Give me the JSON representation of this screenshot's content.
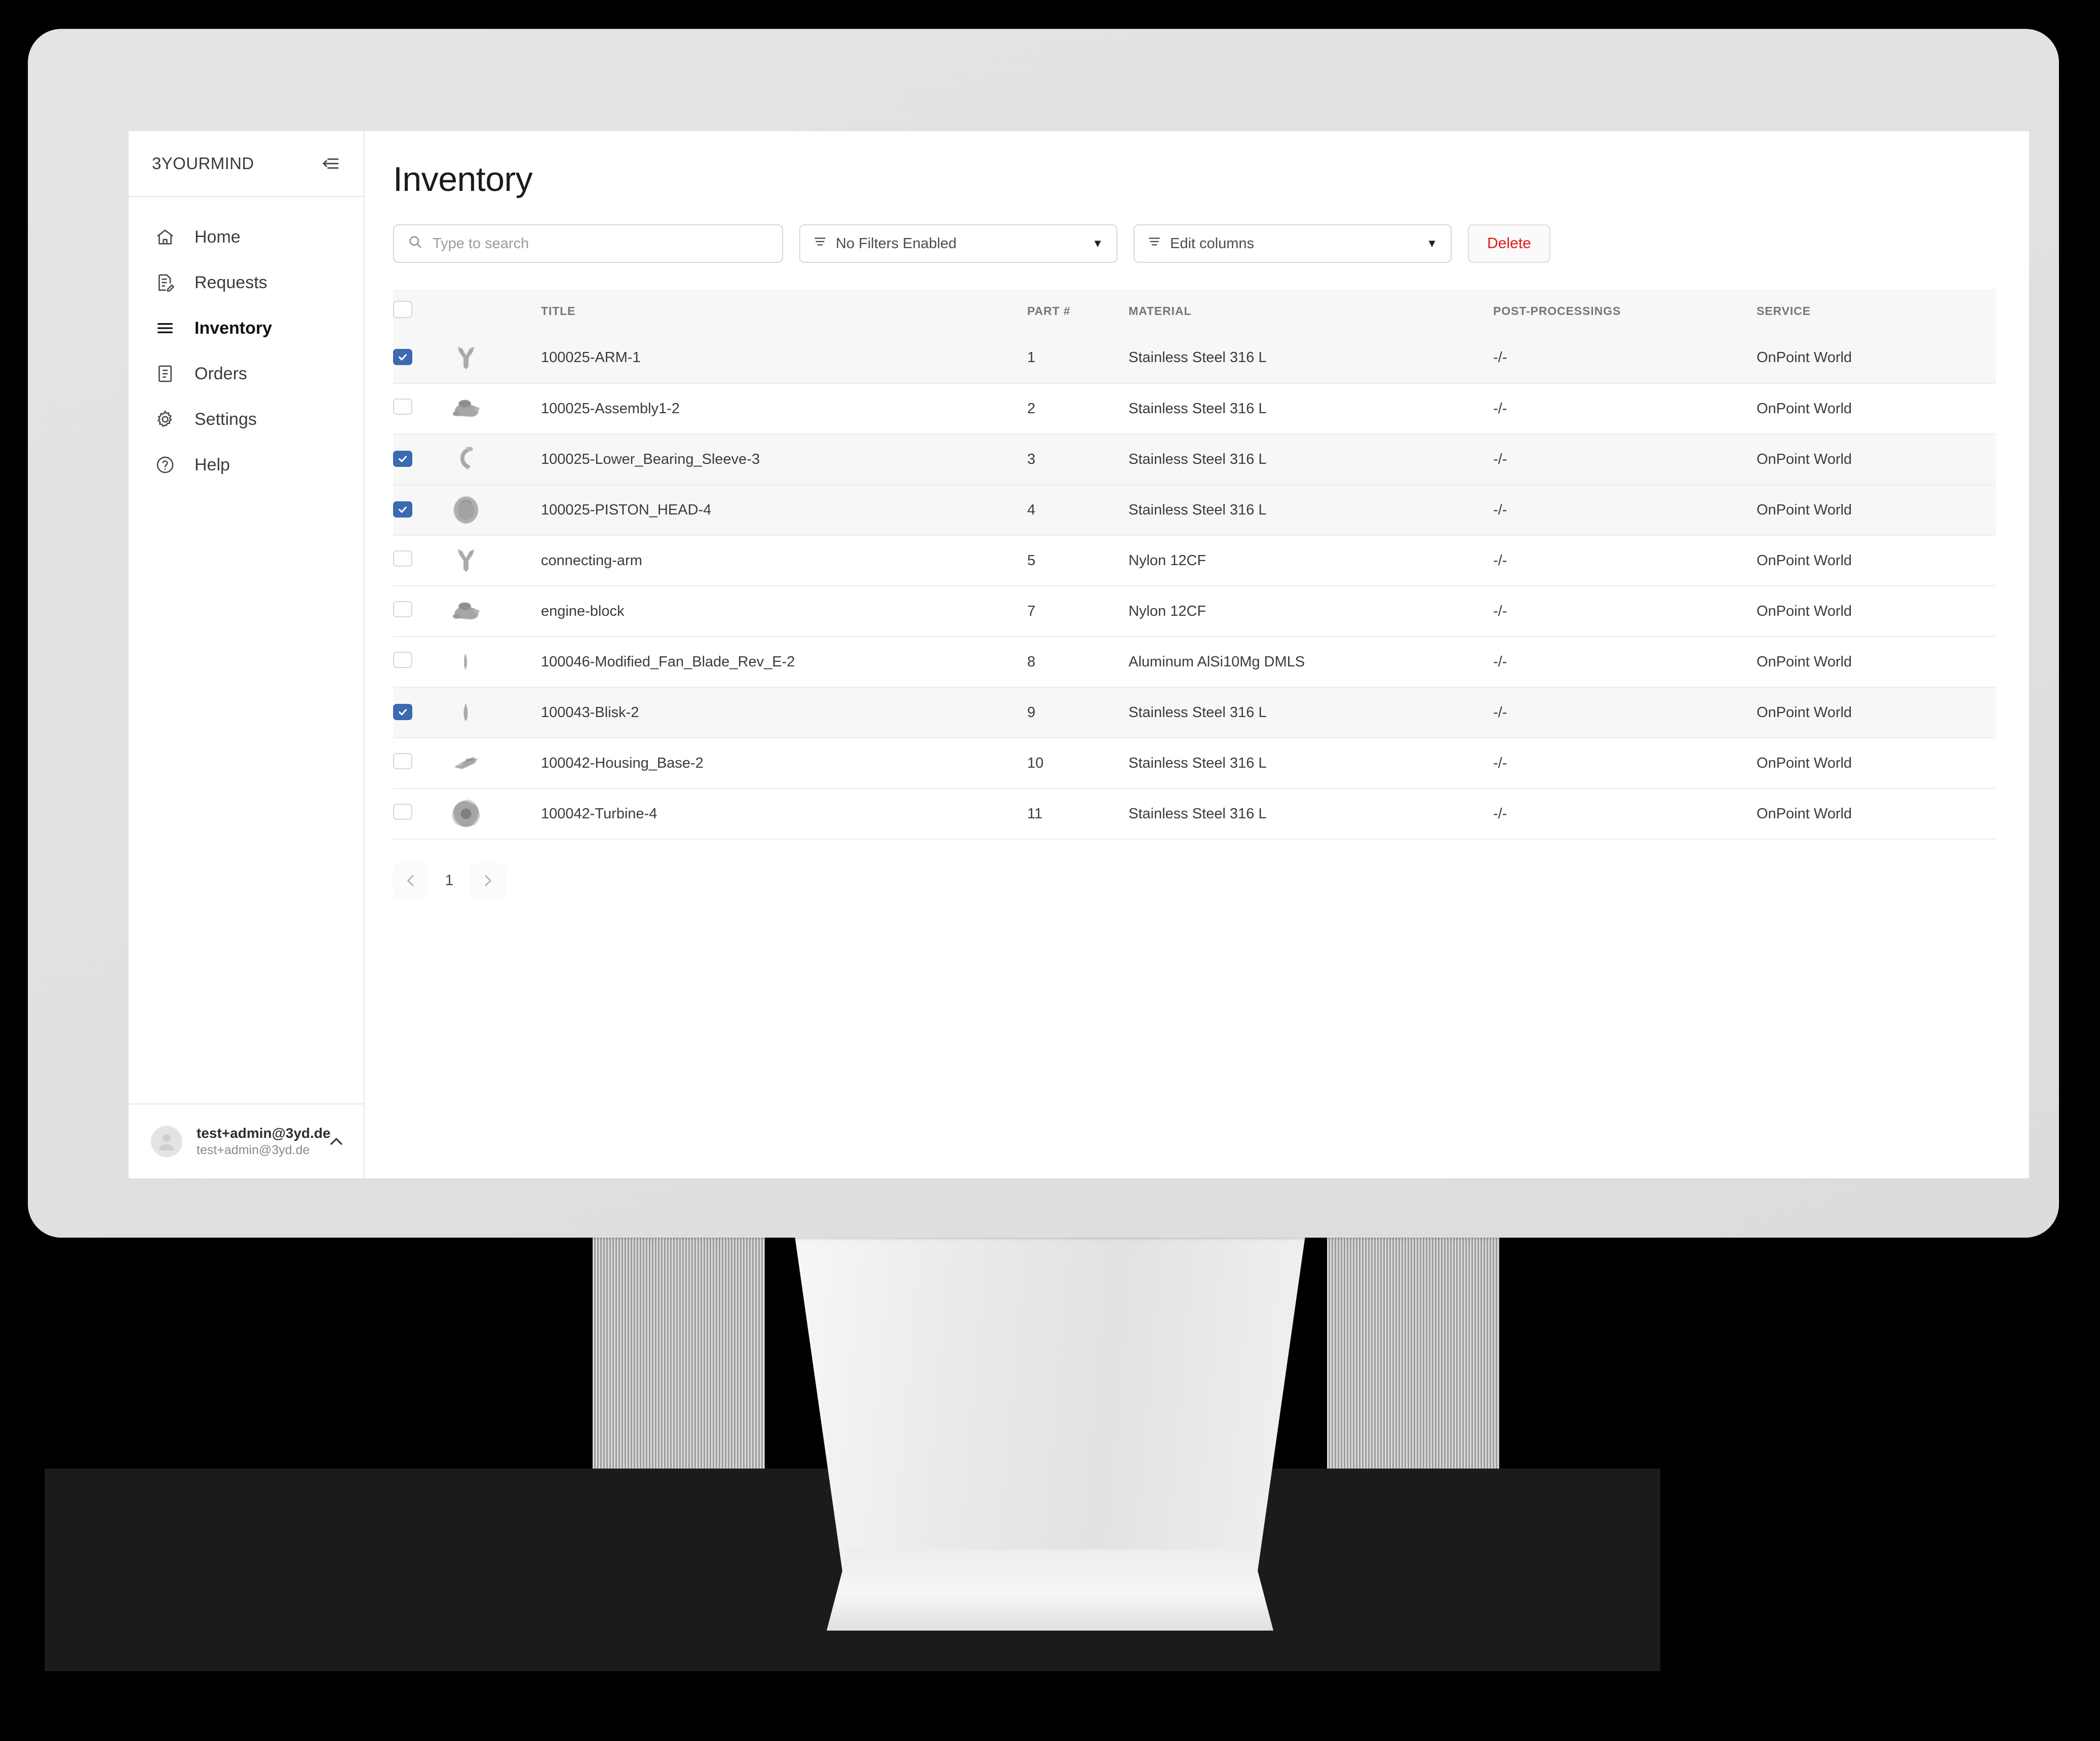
{
  "sidebar": {
    "brand": "3YOURMIND",
    "collapse_icon": "collapse-sidebar-icon",
    "items": [
      {
        "label": "Home",
        "icon": "home-icon",
        "active": false
      },
      {
        "label": "Requests",
        "icon": "document-edit-icon",
        "active": false
      },
      {
        "label": "Inventory",
        "icon": "list-icon",
        "active": true
      },
      {
        "label": "Orders",
        "icon": "document-icon",
        "active": false
      },
      {
        "label": "Settings",
        "icon": "gear-icon",
        "active": false
      },
      {
        "label": "Help",
        "icon": "question-circle-icon",
        "active": false
      }
    ],
    "user": {
      "name": "test+admin@3yd.de",
      "email": "test+admin@3yd.de",
      "chevron_icon": "chevron-up-icon",
      "avatar_icon": "user-avatar-icon"
    }
  },
  "main": {
    "title": "Inventory",
    "toolbar": {
      "search_placeholder": "Type to search",
      "search_value": "",
      "search_icon": "search-icon",
      "filters_label": "No Filters Enabled",
      "filters_icon": "filter-icon",
      "columns_label": "Edit columns",
      "columns_icon": "filter-icon",
      "caret": "▼",
      "delete_label": "Delete",
      "delete_color": "#e01919"
    },
    "table": {
      "columns": [
        "TITLE",
        "PART #",
        "MATERIAL",
        "POST-PROCESSINGS",
        "SERVICE"
      ],
      "header_checkbox_checked": false,
      "rows": [
        {
          "selected": true,
          "thumb": "y-bracket-part-thumbnail",
          "title": "100025-ARM-1",
          "part": "1",
          "material": "Stainless Steel 316 L",
          "post": "-/-",
          "service": "OnPoint World"
        },
        {
          "selected": false,
          "thumb": "engine-block-part-thumbnail",
          "title": "100025-Assembly1-2",
          "part": "2",
          "material": "Stainless Steel 316 L",
          "post": "-/-",
          "service": "OnPoint World"
        },
        {
          "selected": true,
          "thumb": "sleeve-part-thumbnail",
          "title": "100025-Lower_Bearing_Sleeve-3",
          "part": "3",
          "material": "Stainless Steel 316 L",
          "post": "-/-",
          "service": "OnPoint World"
        },
        {
          "selected": true,
          "thumb": "piston-head-part-thumbnail",
          "title": "100025-PISTON_HEAD-4",
          "part": "4",
          "material": "Stainless Steel 316 L",
          "post": "-/-",
          "service": "OnPoint World"
        },
        {
          "selected": false,
          "thumb": "y-bracket-part-thumbnail",
          "title": "connecting-arm",
          "part": "5",
          "material": "Nylon 12CF",
          "post": "-/-",
          "service": "OnPoint World"
        },
        {
          "selected": false,
          "thumb": "engine-block-part-thumbnail",
          "title": "engine-block",
          "part": "7",
          "material": "Nylon 12CF",
          "post": "-/-",
          "service": "OnPoint World"
        },
        {
          "selected": false,
          "thumb": "fan-blade-part-thumbnail",
          "title": "100046-Modified_Fan_Blade_Rev_E-2",
          "part": "8",
          "material": "Aluminum AlSi10Mg DMLS",
          "post": "-/-",
          "service": "OnPoint World"
        },
        {
          "selected": true,
          "thumb": "blisk-part-thumbnail",
          "title": "100043-Blisk-2",
          "part": "9",
          "material": "Stainless Steel 316 L",
          "post": "-/-",
          "service": "OnPoint World"
        },
        {
          "selected": false,
          "thumb": "housing-base-part-thumbnail",
          "title": "100042-Housing_Base-2",
          "part": "10",
          "material": "Stainless Steel 316 L",
          "post": "-/-",
          "service": "OnPoint World"
        },
        {
          "selected": false,
          "thumb": "turbine-part-thumbnail",
          "title": "100042-Turbine-4",
          "part": "11",
          "material": "Stainless Steel 316 L",
          "post": "-/-",
          "service": "OnPoint World"
        }
      ]
    },
    "pagination": {
      "prev_icon": "chevron-left-icon",
      "next_icon": "chevron-right-icon",
      "current_page": "1"
    }
  },
  "theme": {
    "checkbox_blue": "#3a6ab0",
    "delete_red": "#e01919",
    "row_stripe": "#f7f7f7",
    "border": "#ececec"
  }
}
